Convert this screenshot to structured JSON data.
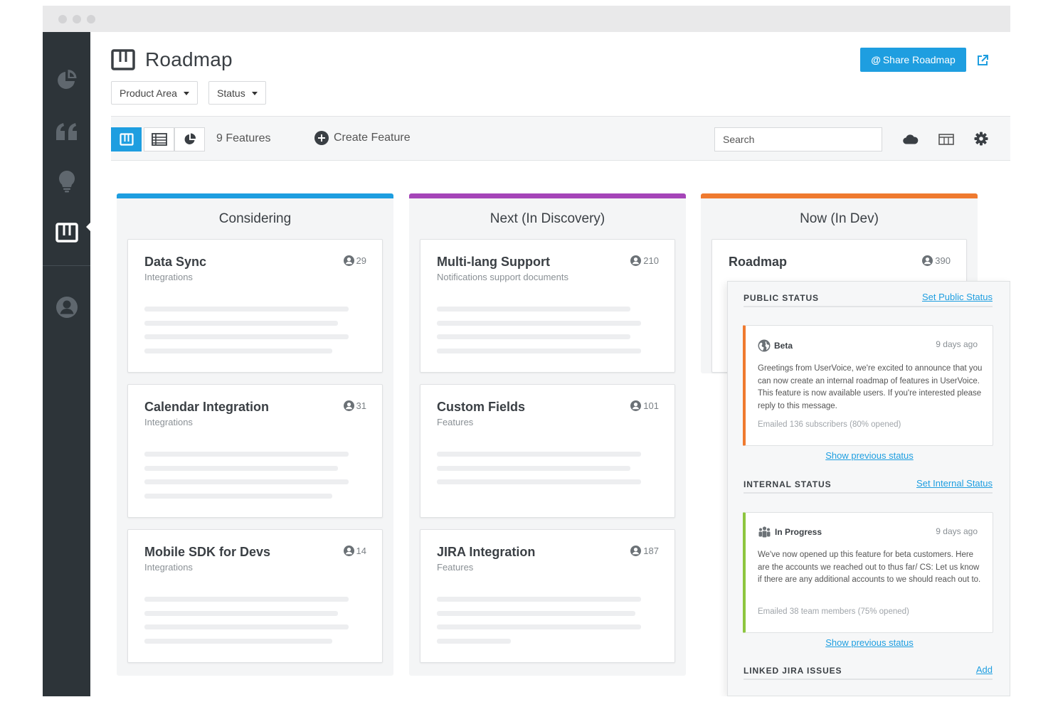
{
  "header": {
    "title": "Roadmap",
    "filters": [
      {
        "label": "Product Area"
      },
      {
        "label": "Status"
      }
    ],
    "share_label": "Share Roadmap",
    "share_at": "@"
  },
  "toolbar": {
    "features_count": "9 Features",
    "create_label": "Create Feature",
    "search_placeholder": "Search"
  },
  "sidebar": {
    "items": [
      {
        "icon": "pie-chart-icon"
      },
      {
        "icon": "quote-icon"
      },
      {
        "icon": "lightbulb-icon"
      },
      {
        "icon": "roadmap-icon",
        "active": true
      },
      {
        "icon": "user-icon"
      }
    ]
  },
  "columns": [
    {
      "title": "Considering",
      "color": "#1e9ee0",
      "cards": [
        {
          "title": "Data Sync",
          "subtitle": "Integrations",
          "votes": "29"
        },
        {
          "title": "Calendar Integration",
          "subtitle": "Integrations",
          "votes": "31"
        },
        {
          "title": "Mobile SDK for Devs",
          "subtitle": "Integrations",
          "votes": "14"
        }
      ]
    },
    {
      "title": "Next (In Discovery)",
      "color": "#a545b8",
      "cards": [
        {
          "title": "Multi-lang Support",
          "subtitle": "Notifications support documents",
          "votes": "210"
        },
        {
          "title": "Custom Fields",
          "subtitle": "Features",
          "votes": "101"
        },
        {
          "title": "JIRA Integration",
          "subtitle": "Features",
          "votes": "187"
        }
      ]
    },
    {
      "title": "Now (In Dev)",
      "color": "#ef7a2f",
      "cards": [
        {
          "title": "Roadmap",
          "subtitle": "",
          "votes": "390"
        }
      ]
    }
  ],
  "panel": {
    "public": {
      "heading": "PUBLIC STATUS",
      "link": "Set Public Status",
      "color": "#ef7a2f",
      "status": "Beta",
      "time": "9 days ago",
      "body": "Greetings from UserVoice, we're excited to announce that you can now create an internal roadmap of features in UserVoice. This feature is now available users. If you're interested please reply to this message.",
      "meta": "Emailed 136 subscribers (80% opened)",
      "show_previous": "Show previous status"
    },
    "internal": {
      "heading": "INTERNAL STATUS",
      "link": "Set Internal Status",
      "color": "#8dc63f",
      "status": "In Progress",
      "time": "9 days ago",
      "body": "We've now opened up this feature for beta customers. Here are the accounts we reached out to thus far/ CS: Let us know if there are any additional accounts to we should reach out to.",
      "meta": "Emailed 38 team members (75% opened)",
      "show_previous": "Show previous status"
    },
    "jira": {
      "heading": "LINKED JIRA ISSUES",
      "link": "Add"
    }
  }
}
